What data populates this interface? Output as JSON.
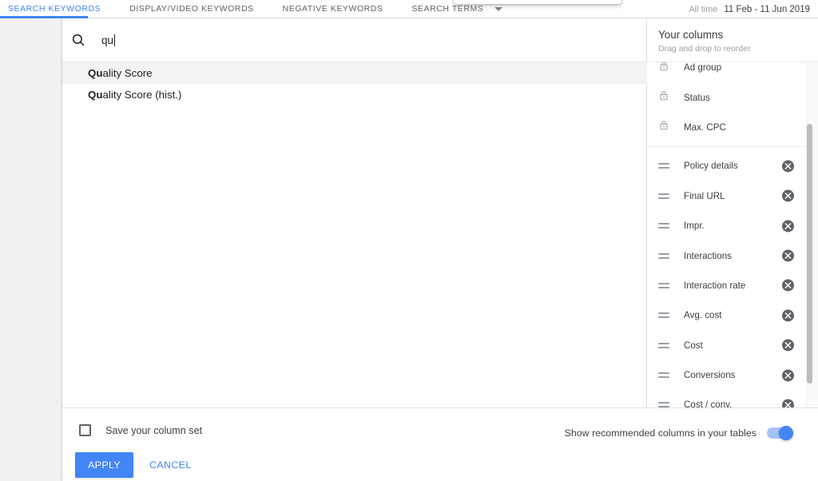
{
  "tabbar": {
    "tabs": [
      {
        "label": "Search keywords",
        "active": true
      },
      {
        "label": "Display/Video keywords",
        "active": false
      },
      {
        "label": "Negative keywords",
        "active": false
      },
      {
        "label": "Search terms",
        "active": false,
        "caret": true
      }
    ],
    "date_range": {
      "preset_label": "All time",
      "value": "11 Feb - 11 Jun 2019"
    },
    "active_accent": "#4285f4"
  },
  "search": {
    "icon": "search-icon",
    "value": "qu",
    "placeholder": "Search",
    "suggestions": [
      {
        "match": "Qu",
        "rest": "ality Score",
        "highlighted": true
      },
      {
        "match": "Qu",
        "rest": "ality Score (hist.)",
        "highlighted": false
      }
    ]
  },
  "your_columns": {
    "title": "Your columns",
    "subtitle": "Drag and drop to reorder",
    "locked_items": [
      {
        "label": "Ad group",
        "icon": "lock-icon",
        "clipped": true
      },
      {
        "label": "Status",
        "icon": "lock-icon"
      },
      {
        "label": "Max. CPC",
        "icon": "lock-icon"
      }
    ],
    "draggable_items": [
      {
        "label": "Policy details"
      },
      {
        "label": "Final URL"
      },
      {
        "label": "Impr."
      },
      {
        "label": "Interactions"
      },
      {
        "label": "Interaction rate"
      },
      {
        "label": "Avg. cost"
      },
      {
        "label": "Cost"
      },
      {
        "label": "Conversions"
      },
      {
        "label": "Cost / conv."
      }
    ],
    "remove_icon": "close-circle-icon",
    "drag_icon": "drag-handle-icon",
    "scrollbar_color": "#bdbdbd"
  },
  "footer": {
    "save_checkbox_label": "Save your column set",
    "save_checkbox_checked": false,
    "recommended_toggle_label": "Show recommended columns in your tables",
    "recommended_toggle_on": true,
    "apply_label": "Apply",
    "cancel_label": "Cancel",
    "accent_color": "#4285f4"
  }
}
